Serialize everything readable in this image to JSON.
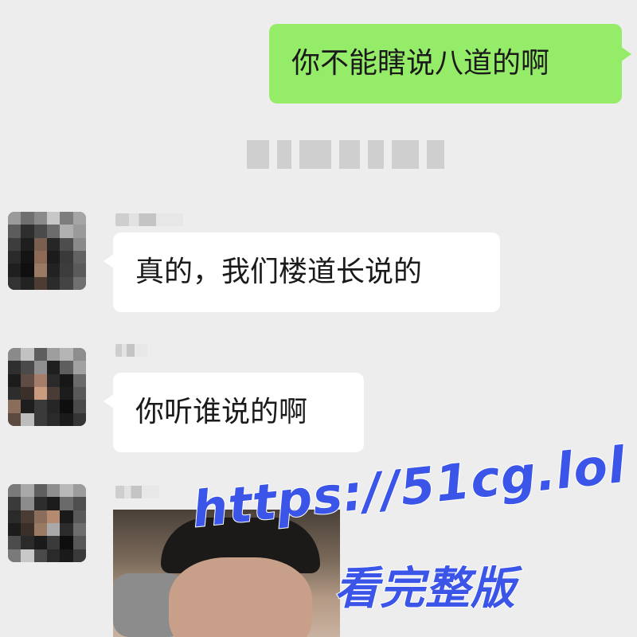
{
  "messages": [
    {
      "direction": "out",
      "text": "你不能瞎说八道的啊"
    },
    {
      "direction": "in",
      "text": "真的，我们楼道长说的"
    },
    {
      "direction": "in",
      "text": "你听谁说的啊"
    },
    {
      "direction": "in",
      "type": "image"
    }
  ],
  "watermark": {
    "url": "https://51cg.lol",
    "caption": "看完整版"
  },
  "colors": {
    "background": "#ededed",
    "outgoing_bubble": "#95ec69",
    "incoming_bubble": "#ffffff",
    "watermark": "#3a55e8"
  }
}
